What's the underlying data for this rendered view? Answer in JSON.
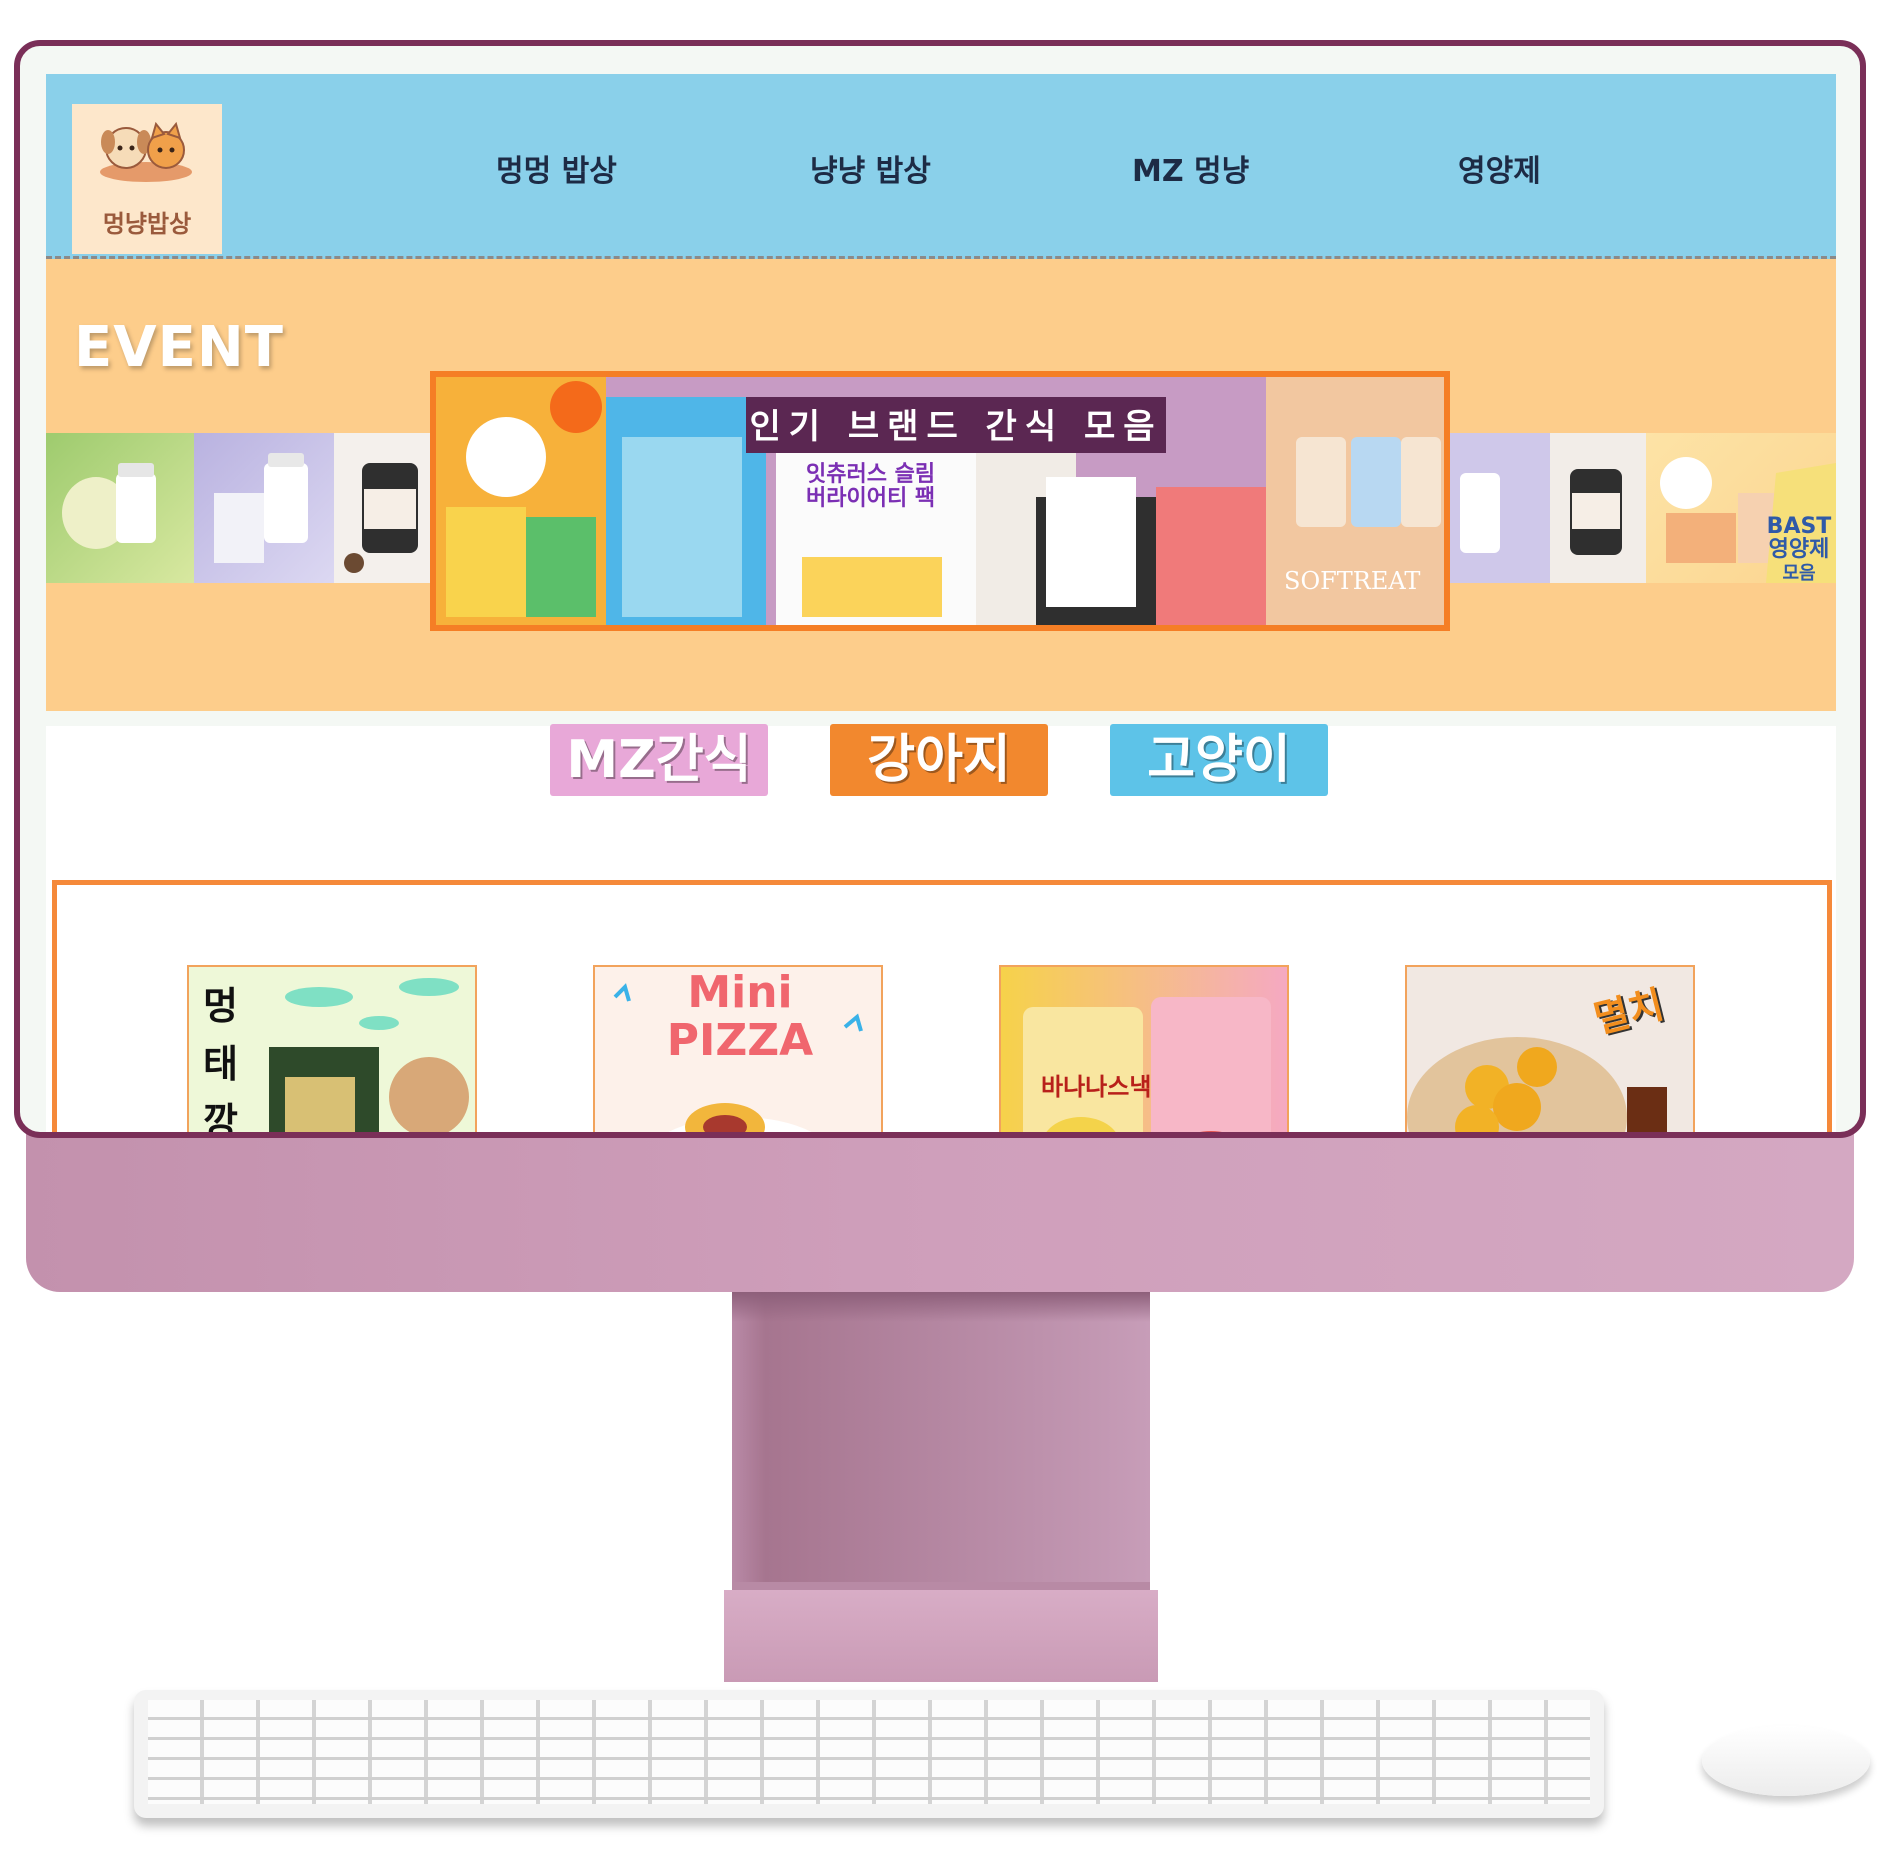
{
  "logo": {
    "text": "멍냥밥상"
  },
  "nav": {
    "items": [
      {
        "label": "멍멍 밥상"
      },
      {
        "label": "냥냥 밥상"
      },
      {
        "label": "MZ 멍냥"
      },
      {
        "label": "영양제"
      }
    ]
  },
  "event": {
    "title": "EVENT",
    "banner_title": "인기 브랜드 간식 모음",
    "banner_sub_line1": "잇츄러스 슬림",
    "banner_sub_line2": "버라이어티 팩",
    "banner_product_label": "SOFTREAT",
    "side_promo_line1": "BAST",
    "side_promo_line2": "영양제",
    "side_promo_line3": "모음"
  },
  "categories": [
    {
      "label": "MZ간식",
      "color": "#e8a8d8"
    },
    {
      "label": "강아지",
      "color": "#f2882e"
    },
    {
      "label": "고양이",
      "color": "#5dc3e8"
    }
  ],
  "products": [
    {
      "label_line1": "멍",
      "label_line2": "태",
      "label_line3": "깡"
    },
    {
      "label_line1": "Mini",
      "label_line2": "PIZZA"
    },
    {
      "label": "바나나스낵"
    },
    {
      "label": "멸치"
    }
  ],
  "colors": {
    "header_bg": "#8ad0ea",
    "event_bg": "#fdcd8b",
    "accent_orange": "#f57e25",
    "monitor_frame": "#7a2f58",
    "monitor_body": "#c99ab5"
  }
}
